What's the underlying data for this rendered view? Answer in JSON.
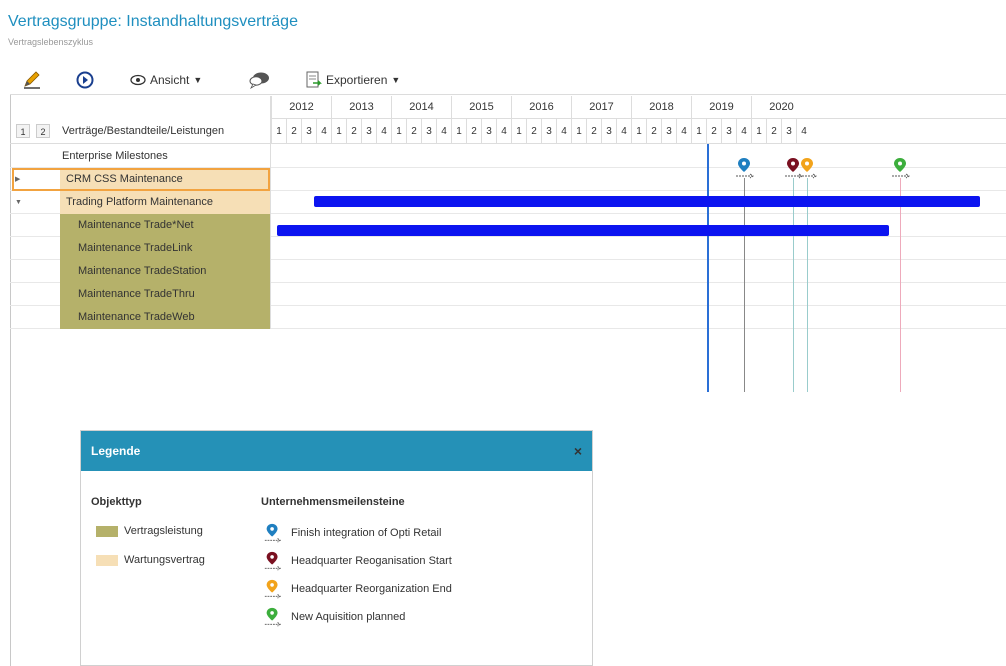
{
  "header": {
    "title": "Vertragsgruppe: Instandhaltungsverträge",
    "subtitle": "Vertragslebenszyklus"
  },
  "toolbar": {
    "edit_icon": "pencil-icon",
    "go_icon": "arrow-circle-icon",
    "view_label": "Ansicht",
    "chat_icon": "speech-bubble-icon",
    "export_label": "Exportieren"
  },
  "timeline": {
    "years": [
      "2012",
      "2013",
      "2014",
      "2015",
      "2016",
      "2017",
      "2018",
      "2019",
      "2020"
    ],
    "quarters": [
      "1",
      "2",
      "3",
      "4"
    ],
    "levels": [
      "1",
      "2"
    ],
    "column_header": "Verträge/Bestandteile/Leistungen"
  },
  "rows": [
    {
      "label": "Enterprise Milestones",
      "type": "milestones"
    },
    {
      "label": "CRM CSS Maintenance",
      "type": "Wartungsvertrag",
      "expander": "▶"
    },
    {
      "label": "Trading Platform Maintenance",
      "type": "Wartungsvertrag",
      "expander": "▼"
    },
    {
      "label": "Maintenance Trade*Net",
      "type": "Vertragsleistung"
    },
    {
      "label": "Maintenance TradeLink",
      "type": "Vertragsleistung"
    },
    {
      "label": "Maintenance TradeStation",
      "type": "Vertragsleistung"
    },
    {
      "label": "Maintenance TradeThru",
      "type": "Vertragsleistung"
    },
    {
      "label": "Maintenance TradeWeb",
      "type": "Vertragsleistung"
    }
  ],
  "colors": {
    "title": "#1f8fbf",
    "bar": "#0c14f0",
    "vertragsleistung": "#b5b16a",
    "wartungsvertrag": "#f6dfb6",
    "legend_header": "#2591b7",
    "milestone_blue": "#1f7fc0",
    "milestone_darkred": "#7a1020",
    "milestone_orange": "#f2a31b",
    "milestone_green": "#3cae3c"
  },
  "legend": {
    "title": "Legende",
    "close": "×",
    "objtype_heading": "Objekttyp",
    "objtypes": [
      "Vertragsleistung",
      "Wartungsvertrag"
    ],
    "milestones_heading": "Unternehmensmeilensteine",
    "milestones": [
      "Finish integration of Opti Retail",
      "Headquarter Reoganisation Start",
      "Headquarter Reorganization End",
      "New Aquisition planned"
    ]
  }
}
